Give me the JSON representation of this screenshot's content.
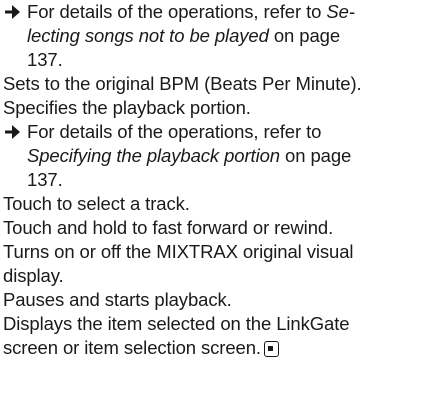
{
  "ref1": {
    "prefix": "For details of the operations, refer to ",
    "italic_1": "Se-",
    "italic_2": "lecting songs not to be played",
    "suffix_2": " on page",
    "page": "137."
  },
  "bpm_text": "Sets to the original BPM (Beats Per Minute).",
  "portion_text": "Specifies the playback portion.",
  "ref2": {
    "prefix": "For details of the operations, refer to",
    "italic": "Specifying the playback portion",
    "suffix": " on page",
    "page": "137."
  },
  "track_select": "Touch to select a track.",
  "track_hold": "Touch and hold to fast forward or rewind.",
  "visual_1": "Turns on or off the MIXTRAX original visual",
  "visual_2": "display.",
  "pause_text": "Pauses and starts playback.",
  "linkgate_1": "Displays the item selected on the LinkGate",
  "linkgate_2": "screen or item selection screen.",
  "icons": {
    "arrow": "right-arrow-icon",
    "end": "end-of-section-icon"
  }
}
